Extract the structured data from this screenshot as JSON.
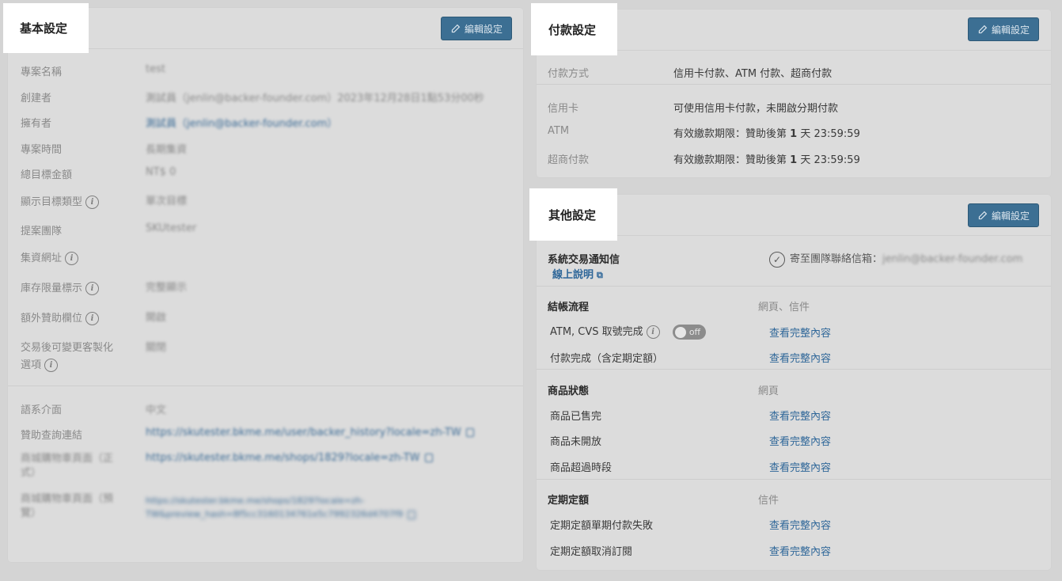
{
  "basic": {
    "title": "基本設定",
    "edit_label": "編輯設定",
    "rows": [
      {
        "label": "專案名稱",
        "value": "test"
      },
      {
        "label": "創建者",
        "value": "測試員（jenlin@backer-founder.com）2023年12月28日1點53分00秒"
      },
      {
        "label": "擁有者",
        "value": "測試員（jenlin@backer-founder.com）"
      },
      {
        "label": "專案時間",
        "value": "長期集資"
      },
      {
        "label": "總目標金額",
        "value": "NT$ 0"
      },
      {
        "label": "顯示目標類型",
        "value": "單次目標"
      },
      {
        "label": "提案團隊",
        "value": "SKUtester"
      },
      {
        "label": "集資網址",
        "value": ""
      },
      {
        "label": "庫存限量標示",
        "value": "完整顯示"
      },
      {
        "label": "額外贊助欄位",
        "value": "開啟"
      },
      {
        "label_line1": "交易後可變更客製化",
        "label_line2": "選項",
        "value": "關閉"
      }
    ],
    "rows2": [
      {
        "label": "語系介面",
        "value": "中文"
      },
      {
        "label": "贊助查詢連結",
        "value": "https://skutester.bkme.me/user/backer_history?locale=zh-TW"
      },
      {
        "label_line1": "商城購物車頁面（正",
        "label_line2": "式）",
        "value": "https://skutester.bkme.me/shops/1829?locale=zh-TW"
      },
      {
        "label_line1": "商城購物車頁面（預",
        "label_line2": "覽）",
        "value_line1": "https://skutester.bkme.me/shops/1829?locale=zh-",
        "value_line2": "TW&preview_hash=8f5cc3160134761e5c7992326d4707f9"
      }
    ]
  },
  "payment": {
    "title": "付款設定",
    "edit_label": "編輯設定",
    "method_label": "付款方式",
    "method_value": "信用卡付款、ATM 付款、超商付款",
    "rows": [
      {
        "label": "信用卡",
        "value": "可使用信用卡付款，未開啟分期付款"
      },
      {
        "label": "ATM",
        "value_pre": "有效繳款期限：贊助後第 ",
        "value_num": "1",
        "value_post": " 天 23:59:59"
      },
      {
        "label": "超商付款",
        "value_pre": "有效繳款期限：贊助後第 ",
        "value_num": "1",
        "value_post": " 天 23:59:59"
      }
    ]
  },
  "other": {
    "title": "其他設定",
    "edit_label": "編輯設定",
    "notify_label": "系統交易通知信",
    "help_link": "線上說明",
    "notify_value": "寄至團隊聯絡信箱：",
    "notify_email": "jenlin@backer-founder.com",
    "checkout": {
      "title": "結帳流程",
      "channel": "網頁、信件",
      "items": [
        {
          "label": "ATM, CVS 取號完成",
          "link": "查看完整內容"
        },
        {
          "label": "付款完成（含定期定額）",
          "link": "查看完整內容"
        }
      ],
      "toggle_label": "off"
    },
    "product": {
      "title": "商品狀態",
      "channel": "網頁",
      "items": [
        {
          "label": "商品已售完",
          "link": "查看完整內容"
        },
        {
          "label": "商品未開放",
          "link": "查看完整內容"
        },
        {
          "label": "商品超過時段",
          "link": "查看完整內容"
        }
      ]
    },
    "recurring": {
      "title": "定期定額",
      "channel": "信件",
      "items": [
        {
          "label": "定期定額單期付款失敗",
          "link": "查看完整內容"
        },
        {
          "label": "定期定額取消訂閱",
          "link": "查看完整內容"
        }
      ]
    }
  }
}
